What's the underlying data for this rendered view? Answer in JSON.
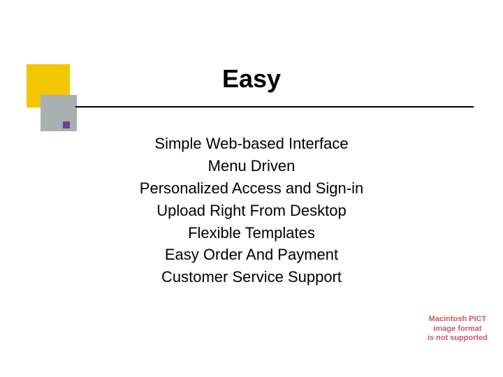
{
  "title": "Easy",
  "bullets": [
    "Simple Web-based Interface",
    "Menu Driven",
    "Personalized Access and Sign-in",
    "Upload Right From Desktop",
    "Flexible Templates",
    "Easy Order And Payment",
    "Customer Service Support"
  ],
  "footer": {
    "line1": "Macintosh PICT",
    "line2": "image format",
    "line3": "is not supported"
  }
}
